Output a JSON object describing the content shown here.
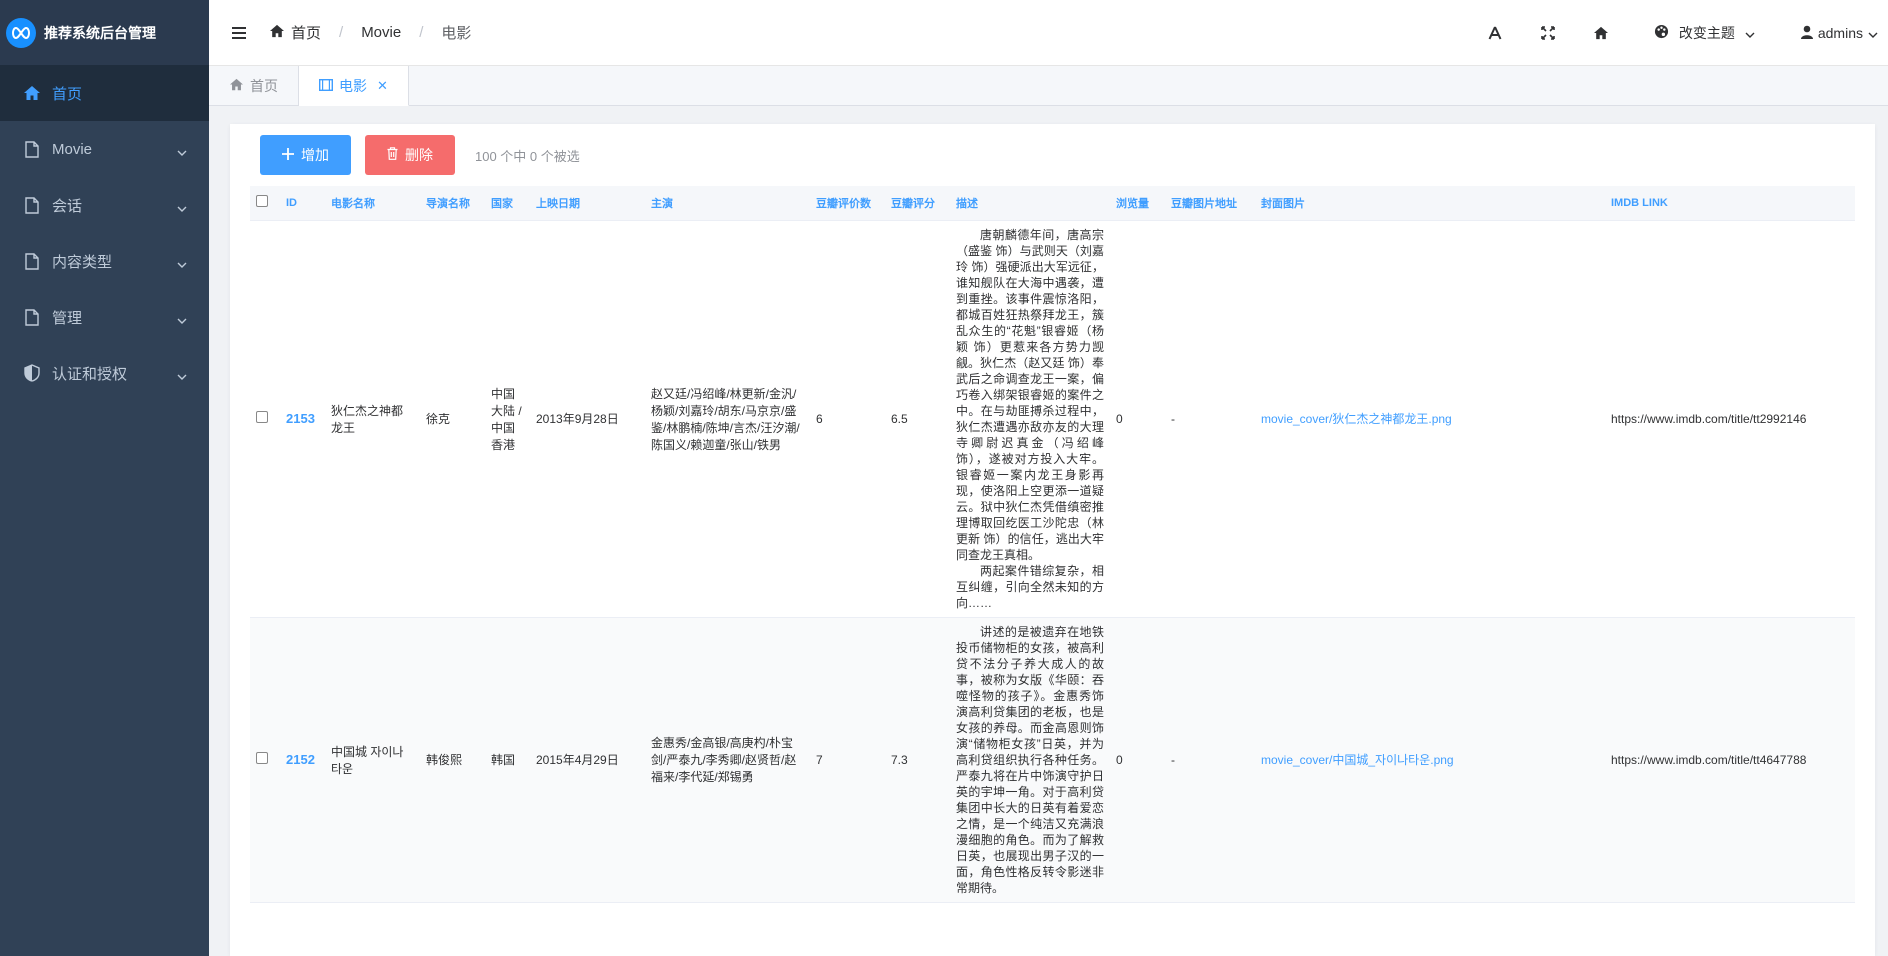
{
  "app": {
    "title": "推荐系统后台管理"
  },
  "sidebar": {
    "items": [
      {
        "label": "首页",
        "icon": "home-icon",
        "active": true
      },
      {
        "label": "Movie",
        "icon": "document-icon"
      },
      {
        "label": "会话",
        "icon": "document-icon"
      },
      {
        "label": "内容类型",
        "icon": "document-icon"
      },
      {
        "label": "管理",
        "icon": "document-icon"
      },
      {
        "label": "认证和授权",
        "icon": "shield-icon"
      }
    ]
  },
  "header": {
    "breadcrumb": [
      "首页",
      "Movie",
      "电影"
    ],
    "theme_label": "改变主题",
    "user_label": "admins"
  },
  "tabs": [
    {
      "label": "首页"
    },
    {
      "label": "电影",
      "active": true
    }
  ],
  "toolbar": {
    "add_label": "增加",
    "delete_label": "删除",
    "selection_text": "100 个中 0 个被选"
  },
  "table": {
    "columns": [
      "ID",
      "电影名称",
      "导演名称",
      "国家",
      "上映日期",
      "主演",
      "豆瓣评价数",
      "豆瓣评分",
      "描述",
      "浏览量",
      "豆瓣图片地址",
      "封面图片",
      "IMDB LINK"
    ],
    "rows": [
      {
        "id": "2153",
        "name": "狄仁杰之神都龙王",
        "director": "徐克",
        "country": "中国大陆 / 中国香港",
        "date": "2013年9月28日",
        "actors": "赵又廷/冯绍峰/林更新/金汎/杨颖/刘嘉玲/胡东/马京京/盛鉴/林鹏楠/陈坤/言杰/汪汐潮/陈国义/赖迦童/张山/铁男",
        "rating_count": "6",
        "rating": "6.5",
        "desc1": "唐朝麟德年间，唐高宗（盛鉴 饰）与武则天（刘嘉玲 饰）强硬派出大军远征，谁知舰队在大海中遇袭，遭到重挫。该事件震惊洛阳，都城百姓狂热祭拜龙王，簇乱众生的“花魁”银睿姬（杨颖 饰）更惹来各方势力觊觎。狄仁杰（赵又廷 饰）奉武后之命调查龙王一案，偏巧卷入绑架银睿姬的案件之中。在与劫匪搏杀过程中，狄仁杰遭遇亦敌亦友的大理寺卿尉迟真金（冯绍峰 饰），遂被对方投入大牢。银睿姬一案内龙王身影再现，使洛阳上空更添一道疑云。狱中狄仁杰凭借缜密推理博取回纥医工沙陀忠（林更新 饰）的信任，逃出大牢同查龙王真相。",
        "desc2": "两起案件错综复杂，相互纠缠，引向全然未知的方向……",
        "views": "0",
        "img_addr": "-",
        "cover": "movie_cover/狄仁杰之神都龙王.png",
        "imdb": "https://www.imdb.com/title/tt2992146"
      },
      {
        "id": "2152",
        "name": "中国城 자이나타운",
        "director": "韩俊熙",
        "country": "韩国",
        "date": "2015年4月29日",
        "actors": "金惠秀/金高银/高庚杓/朴宝剑/严泰九/李秀卿/赵贤哲/赵福来/李代延/郑锡勇",
        "rating_count": "7",
        "rating": "7.3",
        "desc1": "讲述的是被遗弃在地铁投币储物柜的女孩，被高利贷不法分子养大成人的故事，被称为女版《华颐：吞噬怪物的孩子》。金惠秀饰演高利贷集团的老板，也是女孩的养母。而金高恩则饰演“储物柜女孩”日英，并为高利贷组织执行各种任务。严泰九将在片中饰演守护日英的宇坤一角。对于高利贷集团中长大的日英有着爱恋之情，是一个纯洁又充满浪漫细胞的角色。而为了解救日英，也展现出男子汉的一面，角色性格反转令影迷非常期待。",
        "desc2": "",
        "views": "0",
        "img_addr": "-",
        "cover": "movie_cover/中国城_자이나타운.png",
        "imdb": "https://www.imdb.com/title/tt4647788"
      }
    ]
  },
  "colors": {
    "sidebar_bg": "#304156",
    "brand_bg": "#2b3a4f",
    "primary": "#409eff",
    "danger": "#f56c6c"
  }
}
